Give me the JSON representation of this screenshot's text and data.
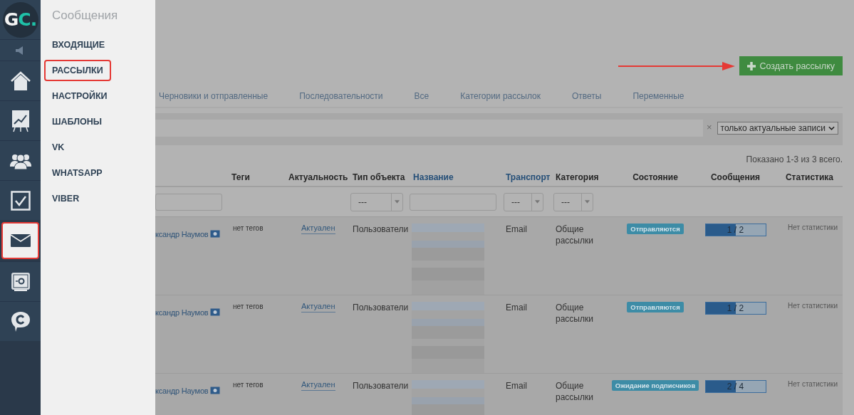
{
  "sidebar": {
    "logo": {
      "letters": "G",
      "accent": "C."
    },
    "icons": [
      {
        "kind": "speaker",
        "highlighted": false
      },
      {
        "kind": "home",
        "highlighted": false
      },
      {
        "kind": "chart",
        "highlighted": false
      },
      {
        "kind": "users",
        "highlighted": false
      },
      {
        "kind": "tasks",
        "highlighted": false
      },
      {
        "kind": "mail",
        "highlighted": true
      },
      {
        "kind": "safe",
        "highlighted": false
      },
      {
        "kind": "chat",
        "highlighted": false
      }
    ]
  },
  "flyout": {
    "title": "Сообщения",
    "items": [
      {
        "label": "ВХОДЯЩИЕ",
        "highlighted": false
      },
      {
        "label": "РАССЫЛКИ",
        "highlighted": true
      },
      {
        "label": "НАСТРОЙКИ",
        "highlighted": false
      },
      {
        "label": "ШАБЛОНЫ",
        "highlighted": false
      },
      {
        "label": "VK",
        "highlighted": false
      },
      {
        "label": "WHATSAPP",
        "highlighted": false
      },
      {
        "label": "VIBER",
        "highlighted": false
      }
    ]
  },
  "create_button": {
    "label": "Создать рассылку"
  },
  "tabs": [
    "Черновики и отправленные",
    "Последовательности",
    "Все",
    "Категории рассылок",
    "Ответы",
    "Переменные"
  ],
  "filter": {
    "clear": "×",
    "scope": "только актуальные записи"
  },
  "summary": "Показано 1-3 из 3 всего.",
  "table": {
    "columns": [
      {
        "filter": {
          "kind": "input"
        }
      },
      {
        "label": "Теги",
        "sortable": false,
        "filter": {
          "kind": "none"
        }
      },
      {
        "label": "Актуальность",
        "sortable": false,
        "filter": {
          "kind": "none"
        }
      },
      {
        "label": "Тип объекта",
        "sortable": false,
        "filter": {
          "kind": "select",
          "value": "---"
        }
      },
      {
        "label": "Название",
        "sortable": true,
        "filter": {
          "kind": "input"
        }
      },
      {
        "label": "Транспорт",
        "sortable": true,
        "filter": {
          "kind": "select",
          "value": "---"
        }
      },
      {
        "label": "Категория",
        "sortable": false,
        "filter": {
          "kind": "select",
          "value": "---"
        }
      },
      {
        "label": "Состояние",
        "sortable": false,
        "filter": {
          "kind": "none"
        }
      },
      {
        "label": "Сообщения",
        "sortable": false,
        "filter": {
          "kind": "none"
        }
      },
      {
        "label": "Статистика",
        "sortable": false,
        "filter": {
          "kind": "none"
        }
      }
    ],
    "rows": [
      {
        "owner": "ксандр Наумов",
        "tags": "нет тегов",
        "relevance": "Актуален",
        "object_type": "Пользователи",
        "transport": "Email",
        "category": "Общие рассылки",
        "status": "Отправляются",
        "messages": {
          "reading": "1 / 2",
          "level": 0.5
        },
        "stats": "Нет статистики"
      },
      {
        "owner": "ксандр Наумов",
        "tags": "нет тегов",
        "relevance": "Актуален",
        "object_type": "Пользователи",
        "transport": "Email",
        "category": "Общие рассылки",
        "status": "Отправляются",
        "messages": {
          "reading": "1 / 2",
          "level": 0.5
        },
        "stats": "Нет статистики"
      },
      {
        "owner": "ксандр Наумов",
        "tags": "нет тегов",
        "relevance": "Актуален",
        "object_type": "Пользователи",
        "transport": "Email",
        "category": "Общие рассылки",
        "status": "Ожидание подписчиков",
        "messages": {
          "reading": "2 / 4",
          "level": 0.5
        },
        "stats": "Нет статистики"
      }
    ]
  }
}
